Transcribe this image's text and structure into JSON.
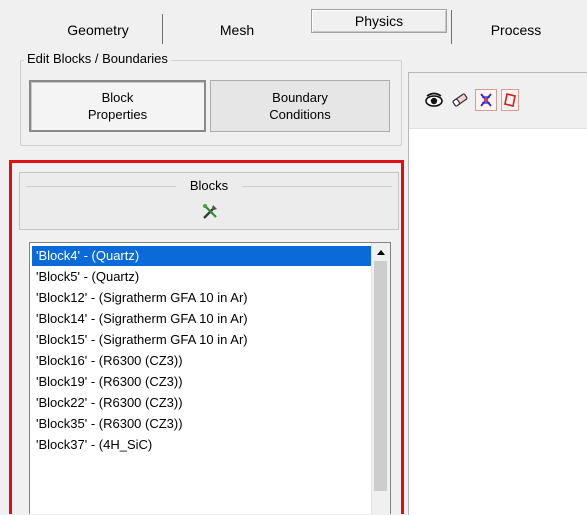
{
  "tabs": [
    {
      "label": "Geometry",
      "active": false
    },
    {
      "label": "Mesh",
      "active": false
    },
    {
      "label": "Physics",
      "active": true
    },
    {
      "label": "Process",
      "active": false
    }
  ],
  "edit_group": {
    "title": "Edit Blocks / Boundaries",
    "block_properties": [
      "Block",
      "Properties"
    ],
    "boundary_conditions": [
      "Boundary",
      "Conditions"
    ]
  },
  "blocks_panel": {
    "title": "Blocks",
    "tool_icon": "tools-icon",
    "items": [
      "'Block4' -  (Quartz)",
      "'Block5' -  (Quartz)",
      "'Block12' -  (Sigratherm GFA 10 in Ar)",
      "'Block14' -  (Sigratherm GFA 10 in Ar)",
      "'Block15' -  (Sigratherm GFA 10 in Ar)",
      "'Block16' -  (R6300 (CZ3))",
      "'Block19' -  (R6300 (CZ3))",
      "'Block22' -  (R6300 (CZ3))",
      "'Block35' -  (R6300 (CZ3))",
      "'Block37' -  (4H_SiC)"
    ],
    "selected_index": 0
  },
  "toolbar_icons": [
    "eye-icon",
    "eraser-icon",
    "mesh-cross-icon",
    "polygon-icon"
  ],
  "colors": {
    "selection": "#0a6ad8",
    "highlight_frame": "#e01010"
  }
}
